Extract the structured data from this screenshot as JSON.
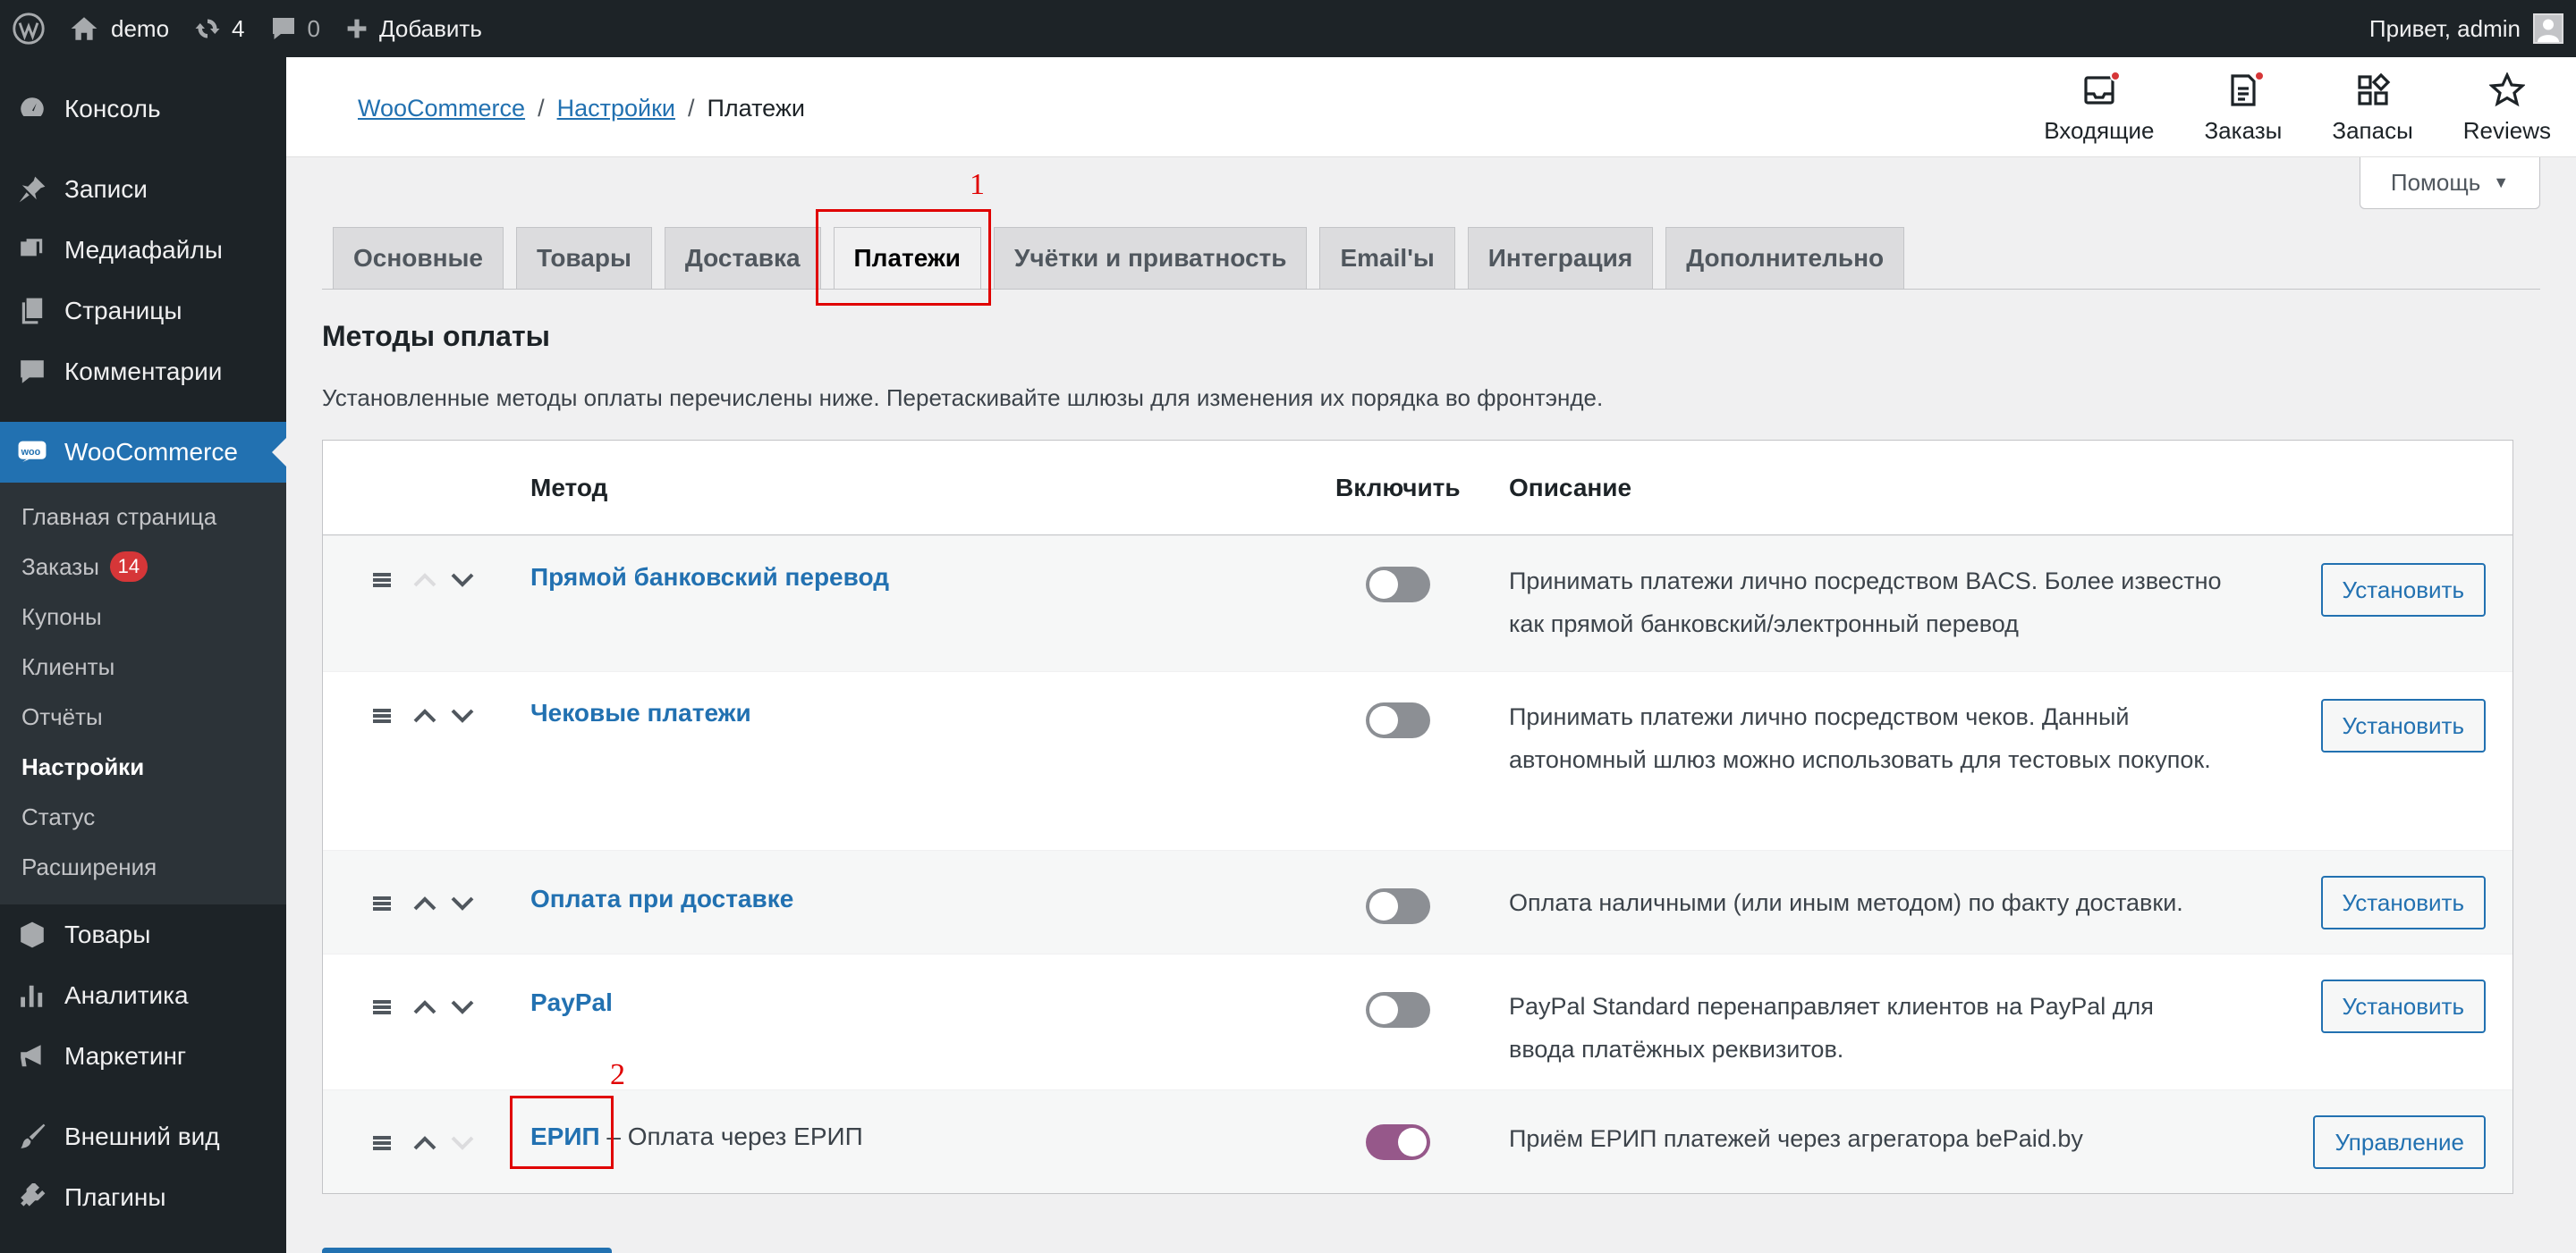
{
  "admin_bar": {
    "site_name": "demo",
    "updates_count": "4",
    "comments_count": "0",
    "add_new_label": "Добавить",
    "greeting": "Привет, admin"
  },
  "sidebar": {
    "items_top": [
      {
        "label": "Консоль",
        "icon": "dashboard-icon"
      },
      {
        "label": "Записи",
        "icon": "pushpin-icon"
      },
      {
        "label": "Медиафайлы",
        "icon": "media-icon"
      },
      {
        "label": "Страницы",
        "icon": "pages-icon"
      },
      {
        "label": "Комментарии",
        "icon": "comments-icon"
      }
    ],
    "woocommerce": {
      "label": "WooCommerce",
      "icon": "woo-icon"
    },
    "submenu": [
      {
        "label": "Главная страница"
      },
      {
        "label": "Заказы",
        "badge": "14"
      },
      {
        "label": "Купоны"
      },
      {
        "label": "Клиенты"
      },
      {
        "label": "Отчёты"
      },
      {
        "label": "Настройки",
        "current": true
      },
      {
        "label": "Статус"
      },
      {
        "label": "Расширения"
      }
    ],
    "items_bottom": [
      {
        "label": "Товары",
        "icon": "products-icon"
      },
      {
        "label": "Аналитика",
        "icon": "analytics-icon"
      },
      {
        "label": "Маркетинг",
        "icon": "megaphone-icon"
      },
      {
        "label": "Внешний вид",
        "icon": "brush-icon"
      },
      {
        "label": "Плагины",
        "icon": "plugins-icon"
      }
    ]
  },
  "breadcrumb": {
    "items": [
      "WooCommerce",
      "Настройки"
    ],
    "separator": "/",
    "current": "Платежи"
  },
  "activity": [
    {
      "label": "Входящие",
      "icon": "inbox-icon",
      "dot": true
    },
    {
      "label": "Заказы",
      "icon": "orders-icon",
      "dot": true
    },
    {
      "label": "Запасы",
      "icon": "stock-icon",
      "dot": false
    },
    {
      "label": "Reviews",
      "icon": "star-icon",
      "dot": false
    }
  ],
  "help": {
    "label": "Помощь",
    "arrow": "▼"
  },
  "tabs": [
    {
      "label": "Основные"
    },
    {
      "label": "Товары"
    },
    {
      "label": "Доставка"
    },
    {
      "label": "Платежи",
      "active": true
    },
    {
      "label": "Учётки и приватность"
    },
    {
      "label": "Email'ы"
    },
    {
      "label": "Интеграция"
    },
    {
      "label": "Дополнительно"
    }
  ],
  "annotations": [
    "1",
    "2"
  ],
  "section": {
    "title": "Методы оплаты",
    "description": "Установленные методы оплаты перечислены ниже. Перетаскивайте шлюзы для изменения их порядка во фронтэнде."
  },
  "table": {
    "headers": {
      "method": "Метод",
      "enable": "Включить",
      "description": "Описание"
    },
    "rows": [
      {
        "name": "Прямой банковский перевод",
        "suffix": "",
        "enabled": false,
        "description": "Принимать платежи лично посредством BACS. Более известно как прямой банковский/электронный перевод",
        "action": "Установить"
      },
      {
        "name": "Чековые платежи",
        "suffix": "",
        "enabled": false,
        "description": "Принимать платежи лично посредством чеков. Данный автономный шлюз можно использовать для тестовых покупок.",
        "action": "Установить"
      },
      {
        "name": "Оплата при доставке",
        "suffix": "",
        "enabled": false,
        "description": "Оплата наличными (или иным методом) по факту доставки.",
        "action": "Установить"
      },
      {
        "name": "PayPal",
        "suffix": "",
        "enabled": false,
        "description": "PayPal Standard перенаправляет клиентов на PayPal для ввода платёжных реквизитов.",
        "action": "Установить"
      },
      {
        "name": "ЕРИП",
        "suffix": " – Оплата через ЕРИП",
        "enabled": true,
        "description": "Приём ЕРИП платежей через агрегатора bePaid.by",
        "action": "Управление"
      }
    ]
  },
  "colors": {
    "accent": "#2271b1",
    "toggle_on": "#96588a",
    "annotation": "#e00000",
    "admin_dark": "#1d2327"
  }
}
